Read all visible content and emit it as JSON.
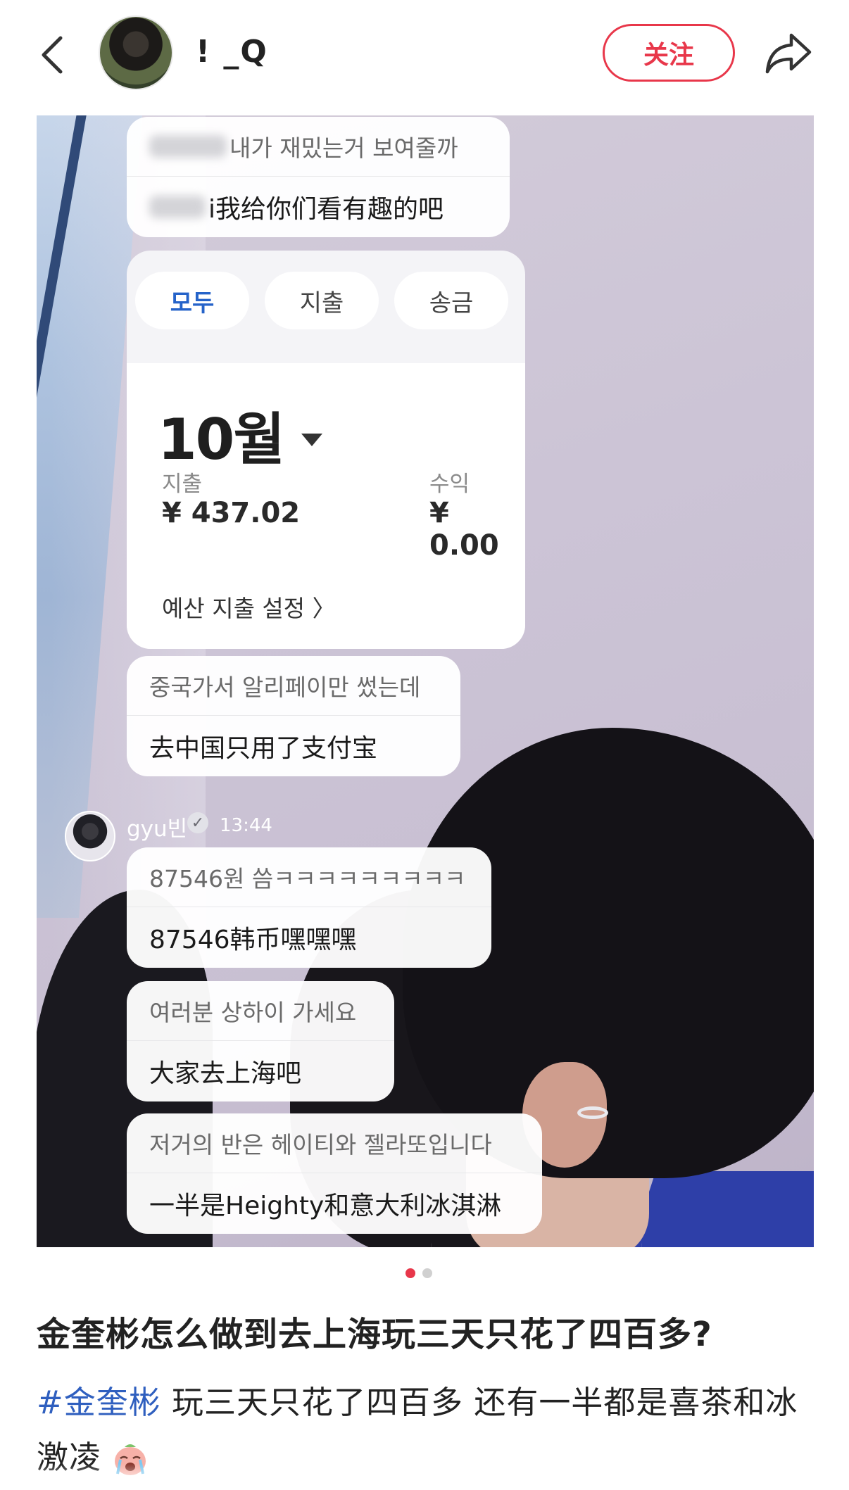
{
  "header": {
    "nickname": "! _Q",
    "follow_label": "关注"
  },
  "chat": {
    "first": {
      "kr": "내가 재밌는거 보여줄까",
      "zh": "i我给你们看有趣的吧"
    },
    "pay": {
      "tabs": [
        "모두",
        "지출",
        "송금"
      ],
      "month": "10월",
      "expense_label": "지출",
      "expense_value": "¥ 437.02",
      "income_label": "수익",
      "income_value": "¥ 0.00",
      "budget_label": "예산 지출 설정 〉"
    },
    "second": {
      "kr": "중국가서 알리페이만 썼는데",
      "zh": "去中国只用了支付宝"
    },
    "sender": {
      "name": "gyu빈",
      "time": "13:44"
    },
    "third": {
      "kr": "87546원 씀ㅋㅋㅋㅋㅋㅋㅋㅋㅋ",
      "zh": "87546韩币嘿嘿嘿"
    },
    "fourth": {
      "kr": "여러분 상하이 가세요",
      "zh": "大家去上海吧"
    },
    "fifth": {
      "kr": "저거의 반은 헤이티와 젤라또입니다",
      "zh": "一半是Heighty和意大利冰淇淋"
    }
  },
  "pagination": {
    "current": 1,
    "total": 2
  },
  "post": {
    "title": "金奎彬怎么做到去上海玩三天只花了四百多?",
    "hashtag": "#金奎彬",
    "body": " 玩三天只花了四百多 还有一半都是喜茶和冰激凌"
  },
  "colors": {
    "accent": "#e8374a",
    "link": "#2f5fbf",
    "alipay_blue": "#2563c9"
  },
  "icons": {
    "back": "chevron-left-icon",
    "share": "share-arrow-icon",
    "verified": "verified-badge-icon",
    "emoji": "crying-face-emoji-icon"
  }
}
